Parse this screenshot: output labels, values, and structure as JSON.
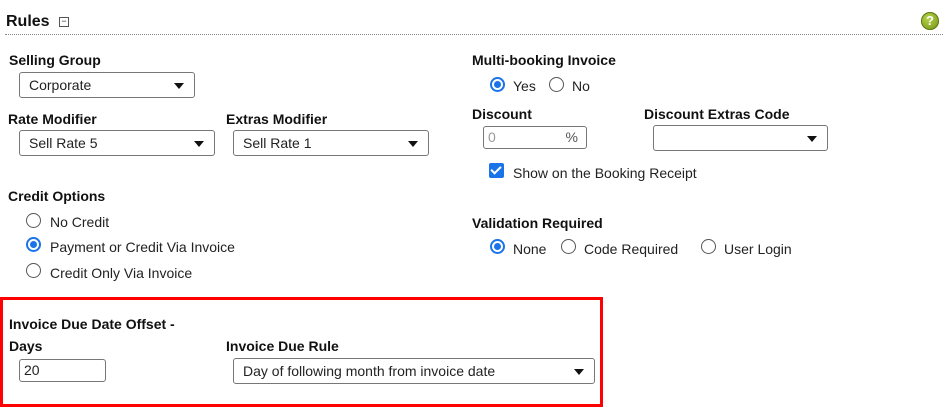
{
  "rules": {
    "title": "Rules",
    "collapse_symbol": "⊟",
    "help_symbol": "?"
  },
  "selling_group": {
    "label": "Selling Group",
    "value": "Corporate"
  },
  "rate_modifier": {
    "label": "Rate Modifier",
    "value": "Sell Rate 5"
  },
  "extras_modifier": {
    "label": "Extras Modifier",
    "value": "Sell Rate 1"
  },
  "credit_options": {
    "label": "Credit Options",
    "options": [
      "No Credit",
      "Payment or Credit Via Invoice",
      "Credit Only Via Invoice"
    ],
    "selected": "Payment or Credit Via Invoice"
  },
  "multi_booking_invoice": {
    "label": "Multi-booking Invoice",
    "options": [
      "Yes",
      "No"
    ],
    "selected": "Yes"
  },
  "discount": {
    "label": "Discount",
    "placeholder": "0",
    "unit": "%"
  },
  "discount_extras_code": {
    "label": "Discount Extras Code",
    "value": ""
  },
  "show_on_receipt": {
    "label": "Show on the Booking Receipt",
    "checked": true
  },
  "validation_required": {
    "label": "Validation Required",
    "options": [
      "None",
      "Code Required",
      "User Login"
    ],
    "selected": "None"
  },
  "invoice_due_offset": {
    "label_line1": "Invoice Due Date Offset -",
    "label_line2": "Days",
    "value": "20"
  },
  "invoice_due_rule": {
    "label": "Invoice Due Rule",
    "value": "Day of following month from invoice date"
  },
  "colors": {
    "accent": "#1a73e8",
    "highlight_border": "#ff0000",
    "help_icon": "#8db21f"
  }
}
